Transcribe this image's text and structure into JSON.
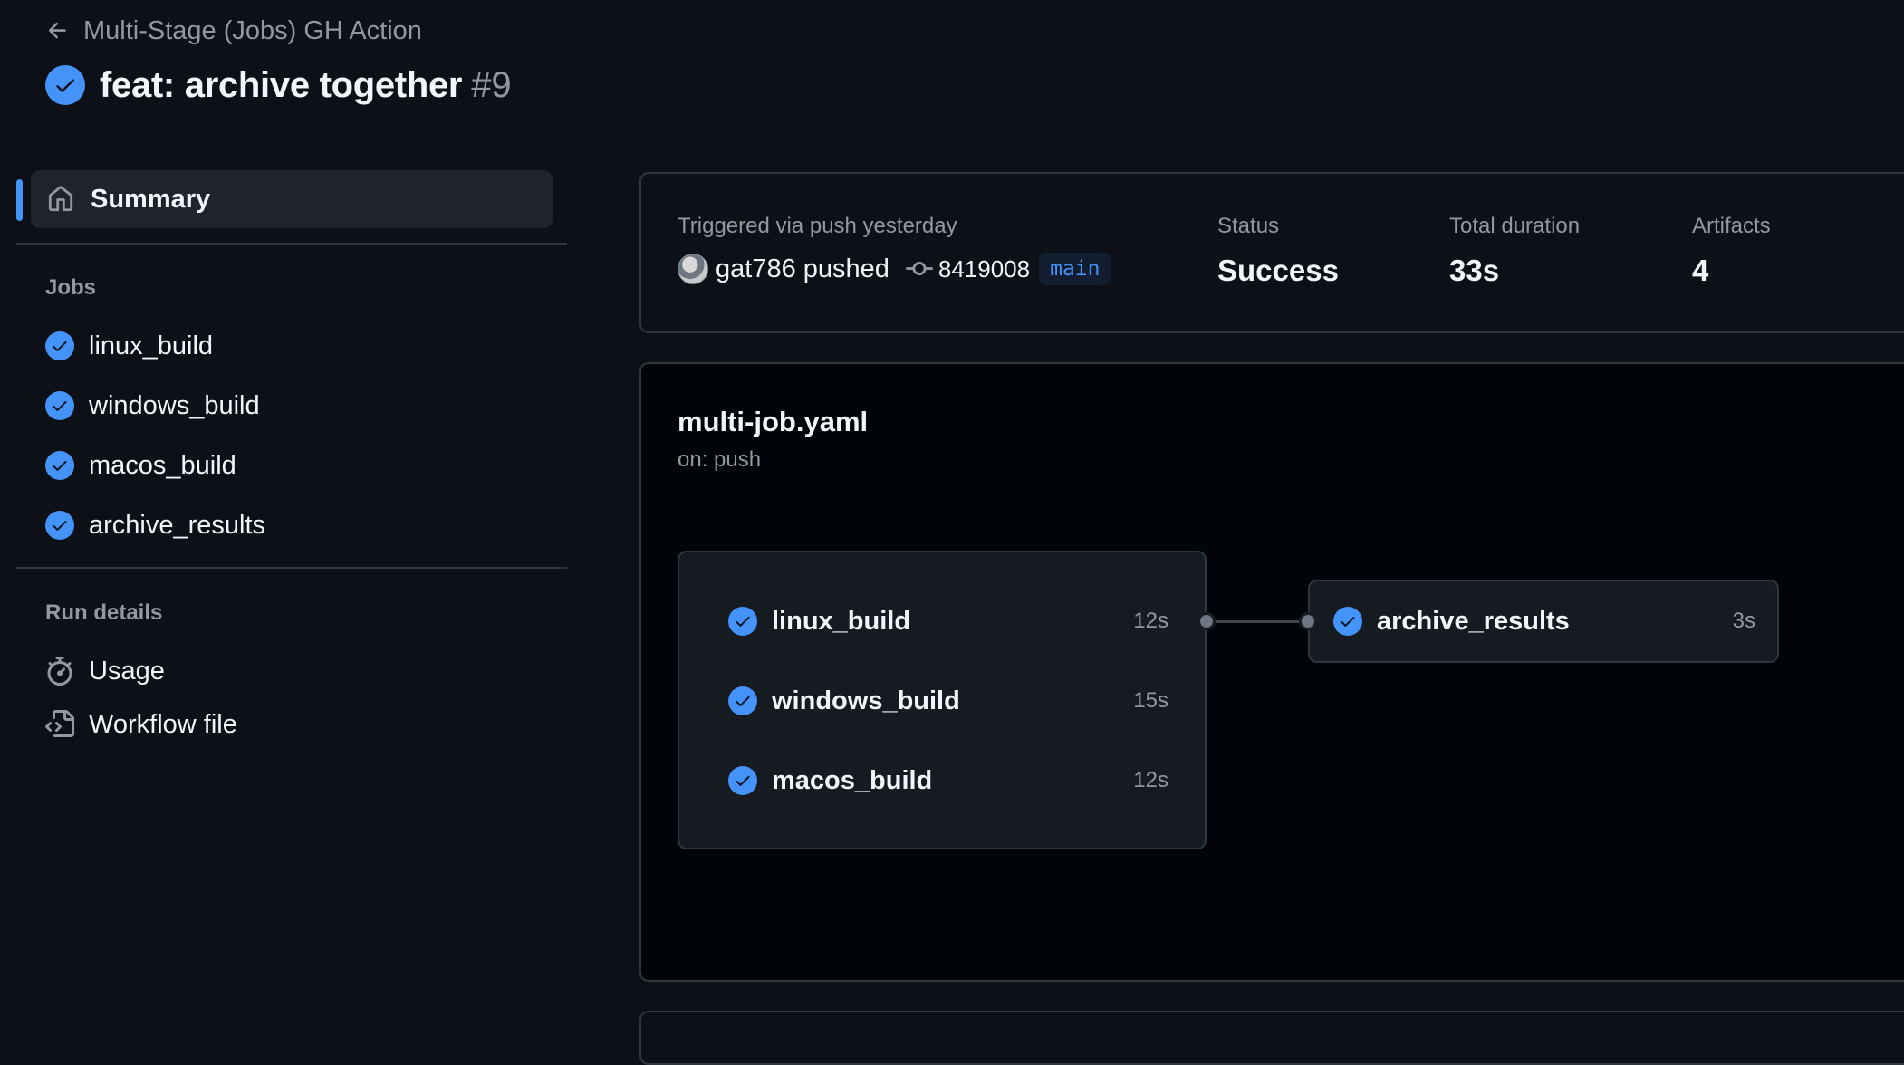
{
  "header": {
    "workflow_name": "Multi-Stage (Jobs) GH Action",
    "run_title": "feat: archive together",
    "run_number": "#9"
  },
  "sidebar": {
    "summary_label": "Summary",
    "jobs_heading": "Jobs",
    "jobs": [
      {
        "name": "linux_build",
        "status": "success"
      },
      {
        "name": "windows_build",
        "status": "success"
      },
      {
        "name": "macos_build",
        "status": "success"
      },
      {
        "name": "archive_results",
        "status": "success"
      }
    ],
    "run_details_heading": "Run details",
    "run_details": [
      {
        "label": "Usage",
        "icon": "stopwatch-icon"
      },
      {
        "label": "Workflow file",
        "icon": "file-code-icon"
      }
    ]
  },
  "summary": {
    "trigger_text": "Triggered via push yesterday",
    "actor": "gat786",
    "action": "pushed",
    "commit_sha": "8419008",
    "branch": "main",
    "status_label": "Status",
    "status_value": "Success",
    "duration_label": "Total duration",
    "duration_value": "33s",
    "artifacts_label": "Artifacts",
    "artifacts_value": "4"
  },
  "graph": {
    "workflow_file": "multi-job.yaml",
    "trigger": "on: push",
    "group_jobs": [
      {
        "name": "linux_build",
        "duration": "12s"
      },
      {
        "name": "windows_build",
        "duration": "15s"
      },
      {
        "name": "macos_build",
        "duration": "12s"
      }
    ],
    "downstream_job": {
      "name": "archive_results",
      "duration": "3s"
    }
  },
  "colors": {
    "background": "#0d1117",
    "accent": "#4493f8",
    "success": "#4493f8",
    "border": "#30363d"
  }
}
